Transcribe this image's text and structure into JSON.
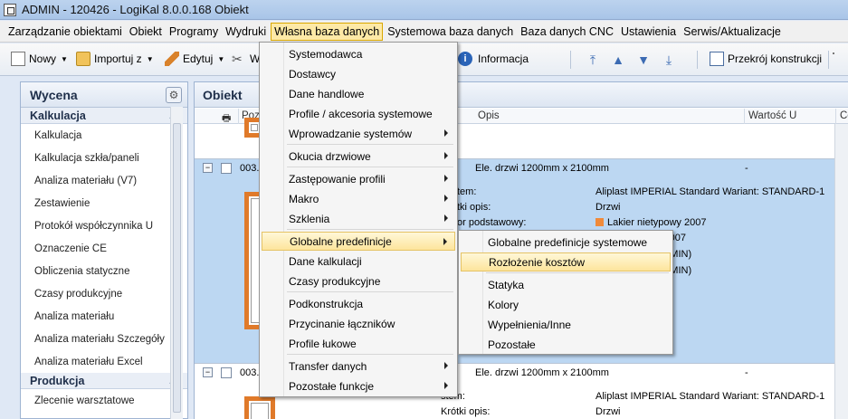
{
  "window": {
    "title": "ADMIN - 120426 - LogiKal 8.0.0.168 Obiekt"
  },
  "menubar": {
    "items": [
      "Zarządzanie obiektami",
      "Obiekt",
      "Programy",
      "Wydruki",
      "Własna baza danych",
      "Systemowa baza danych",
      "Baza danych CNC",
      "Ustawienia",
      "Serwis/Aktualizacje"
    ],
    "active_index": 4
  },
  "toolbar": {
    "new_label": "Nowy",
    "import_label": "Importuj z",
    "edit_label": "Edytuj",
    "cut_partial": "W",
    "info_label": "Informacja",
    "cross_section_label": "Przekrój konstrukcji"
  },
  "left_panel": {
    "title": "Wycena",
    "groups": [
      {
        "name": "Kalkulacja",
        "items": [
          "Kalkulacja",
          "Kalkulacja szkła/paneli",
          "Analiza materiału (V7)",
          "Zestawienie",
          "Protokół współczynnika U",
          "Oznaczenie CE",
          "Obliczenia statyczne",
          "Czasy produkcyjne",
          "Analiza materiału",
          "Analiza materiału Szczegóły",
          "Analiza materiału Excel"
        ]
      },
      {
        "name": "Produkcja",
        "items": [
          "Zlecenie warsztatowe"
        ]
      }
    ]
  },
  "main_panel": {
    "title": "Obiekt",
    "columns": {
      "pos": "Poz",
      "desc": "Opis",
      "value": "Wartość U",
      "extra": "Ce"
    },
    "rows": [
      {
        "pos": "003.",
        "desc": "Ele. drzwi 1200mm x 2100mm",
        "value": "-",
        "details": [
          {
            "label": "tem:",
            "value": "Aliplast IMPERIAL Standard Wariant: STANDARD-1"
          },
          {
            "label": "tki opis:",
            "value": "Drzwi"
          },
          {
            "label": "or podstawowy:",
            "value": "Lakier nietypowy 2007"
          },
          {
            "label": "",
            "value": "y 2007"
          },
          {
            "label": "",
            "value": "ADMIN)"
          },
          {
            "label": "",
            "value": "ADMIN)"
          }
        ]
      },
      {
        "pos": "003.",
        "desc": "Ele. drzwi 1200mm x 2100mm",
        "value": "-",
        "details": [
          {
            "label": "stem:",
            "value": "Aliplast IMPERIAL Standard Wariant: STANDARD-1"
          },
          {
            "label": "Krótki opis:",
            "value": "Drzwi"
          }
        ]
      }
    ]
  },
  "dropdown": {
    "items": [
      {
        "label": "Systemodawca",
        "sub": false
      },
      {
        "label": "Dostawcy",
        "sub": false
      },
      {
        "label": "Dane handlowe",
        "sub": false
      },
      {
        "label": "Profile / akcesoria systemowe",
        "sub": false
      },
      {
        "label": "Wprowadzanie systemów",
        "sub": true
      },
      {
        "label": "Okucia drzwiowe",
        "sub": true
      },
      {
        "label": "Zastępowanie profili",
        "sub": true
      },
      {
        "label": "Makro",
        "sub": true
      },
      {
        "label": "Szklenia",
        "sub": true
      },
      {
        "label": "Globalne predefinicje",
        "sub": true
      },
      {
        "label": "Dane kalkulacji",
        "sub": false
      },
      {
        "label": "Czasy produkcyjne",
        "sub": false
      },
      {
        "label": "Podkonstrukcja",
        "sub": false
      },
      {
        "label": "Przycinanie łączników",
        "sub": false
      },
      {
        "label": "Profile łukowe",
        "sub": false
      },
      {
        "label": "Transfer danych",
        "sub": true
      },
      {
        "label": "Pozostałe funkcje",
        "sub": true
      }
    ],
    "highlighted_index": 9
  },
  "submenu": {
    "items": [
      "Globalne predefinicje systemowe",
      "Rozłożenie kosztów",
      "Statyka",
      "Kolory",
      "Wypełnienia/Inne",
      "Pozostałe"
    ],
    "highlighted_index": 1
  },
  "colors": {
    "highlight": "#fde59c",
    "selected_row": "#bcd7f2",
    "window_frame": "#e07a2a"
  }
}
